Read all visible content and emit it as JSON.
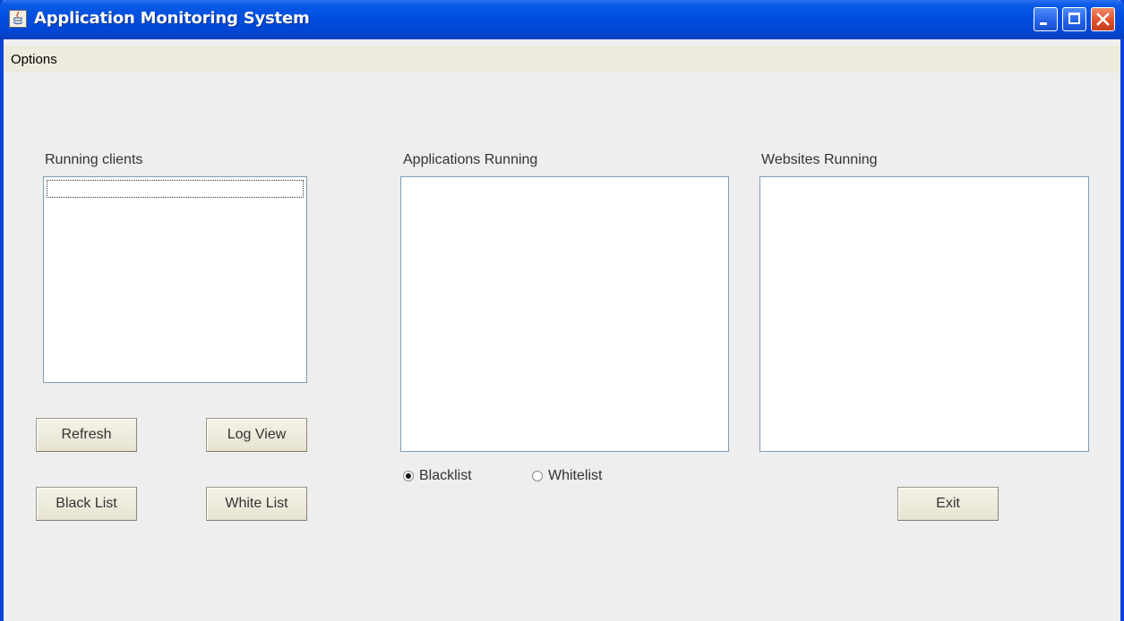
{
  "window": {
    "title": "Application Monitoring System"
  },
  "menu": {
    "items": [
      "Options"
    ]
  },
  "panels": {
    "clients": {
      "label": "Running clients"
    },
    "applications": {
      "label": "Applications Running"
    },
    "websites": {
      "label": "Websites Running"
    }
  },
  "buttons": {
    "refresh": "Refresh",
    "log_view": "Log View",
    "black_list": "Black List",
    "white_list": "White List",
    "exit": "Exit"
  },
  "list_mode": {
    "options": [
      "Blacklist",
      "Whitelist"
    ],
    "selected": "Blacklist"
  },
  "colors": {
    "title_bar": "#0050e0",
    "window_bg": "#eeeeee",
    "menu_bg": "#efebdc",
    "close_button": "#e0522c"
  }
}
